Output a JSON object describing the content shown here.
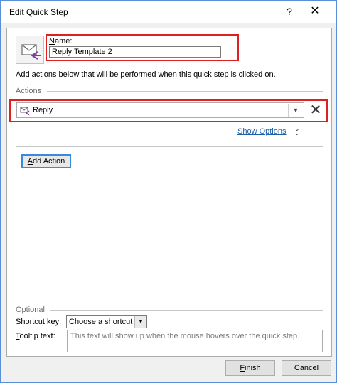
{
  "window": {
    "title": "Edit Quick Step"
  },
  "titlebar": {
    "help": "?",
    "close": "✕"
  },
  "name": {
    "label": "Name:",
    "value": "Reply Template 2"
  },
  "instructions": "Add actions below that will be performed when this quick step is clicked on.",
  "actions": {
    "section_label": "Actions",
    "selected_action": "Reply",
    "remove_symbol": "✕",
    "show_options": "Show Options",
    "add_action": "Add Action"
  },
  "optional": {
    "section_label": "Optional",
    "shortcut_label": "Shortcut key:",
    "shortcut_value": "Choose a shortcut",
    "tooltip_label": "Tooltip text:",
    "tooltip_placeholder": "This text will show up when the mouse hovers over the quick step."
  },
  "buttons": {
    "finish": "Finish",
    "cancel": "Cancel"
  },
  "colors": {
    "highlight": "#e02020",
    "link": "#1a5fa8",
    "focus": "#3b8ad9",
    "frame": "#5a8fd6"
  }
}
